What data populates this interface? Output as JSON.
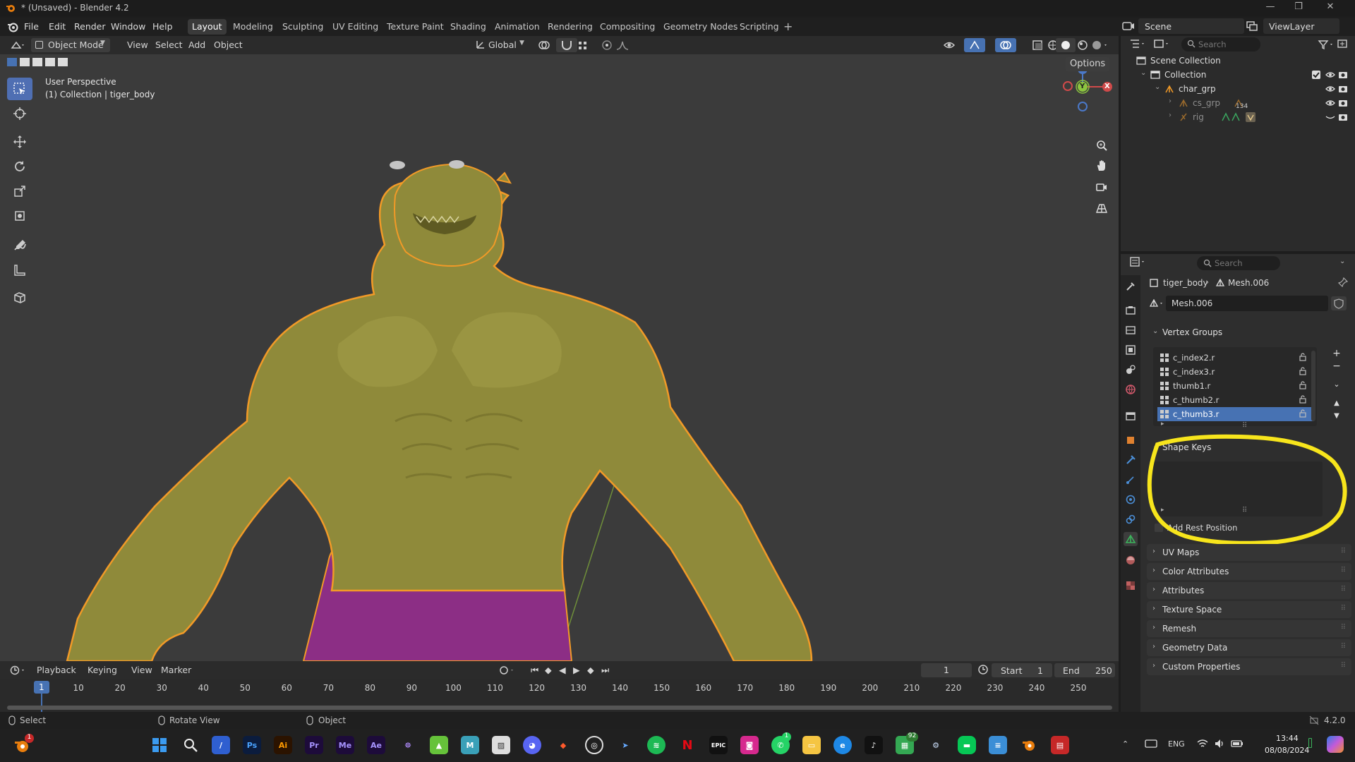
{
  "window": {
    "title": "* (Unsaved) - Blender 4.2"
  },
  "menubar": {
    "menus": [
      "File",
      "Edit",
      "Render",
      "Window",
      "Help"
    ],
    "workspaces": [
      "Layout",
      "Modeling",
      "Sculpting",
      "UV Editing",
      "Texture Paint",
      "Shading",
      "Animation",
      "Rendering",
      "Compositing",
      "Geometry Nodes",
      "Scripting"
    ],
    "active_workspace": "Layout",
    "scene_label": "Scene",
    "viewlayer_label": "ViewLayer"
  },
  "viewport_header": {
    "mode": "Object Mode",
    "menus": [
      "View",
      "Select",
      "Add",
      "Object"
    ],
    "transform": "Global",
    "options": "Options"
  },
  "viewport": {
    "perspective": "User Perspective",
    "collection_info": "(1) Collection | tiger_body",
    "gizmo_axes": [
      "Z",
      "Y",
      "X"
    ]
  },
  "outliner": {
    "search_placeholder": "Search",
    "rows": [
      {
        "label": "Scene Collection",
        "depth": 0
      },
      {
        "label": "Collection",
        "depth": 1
      },
      {
        "label": "char_grp",
        "depth": 2
      },
      {
        "label": "cs_grp",
        "depth": 3,
        "badge": "134"
      },
      {
        "label": "rig",
        "depth": 3
      }
    ]
  },
  "properties": {
    "search_placeholder": "Search",
    "breadcrumb": {
      "object": "tiger_body",
      "data": "Mesh.006"
    },
    "mesh_name": "Mesh.006",
    "vertex_groups": {
      "title": "Vertex Groups",
      "items": [
        "c_index2.r",
        "c_index3.r",
        "thumb1.r",
        "c_thumb2.r",
        "c_thumb3.r"
      ],
      "selected": "c_thumb3.r"
    },
    "shape_keys": {
      "title": "Shape Keys",
      "add_rest_position": "Add Rest Position"
    },
    "panels": [
      "UV Maps",
      "Color Attributes",
      "Attributes",
      "Texture Space",
      "Remesh",
      "Geometry Data",
      "Custom Properties"
    ]
  },
  "timeline": {
    "menus": [
      "Playback",
      "Keying",
      "View",
      "Marker"
    ],
    "current_frame": "1",
    "start_label": "Start",
    "start": "1",
    "end_label": "End",
    "end": "250",
    "ticks": [
      "1",
      "10",
      "20",
      "30",
      "40",
      "50",
      "60",
      "70",
      "80",
      "90",
      "100",
      "110",
      "120",
      "130",
      "140",
      "150",
      "160",
      "170",
      "180",
      "190",
      "200",
      "210",
      "220",
      "230",
      "240",
      "250"
    ]
  },
  "statusbar": {
    "select": "Select",
    "rotate": "Rotate View",
    "object": "Object",
    "version": "4.2.0"
  },
  "taskbar": {
    "language": "ENG",
    "time": "13:44",
    "date": "08/08/2024",
    "badges": {
      "notif": "1",
      "whatsapp": "1",
      "app92": "92"
    }
  },
  "colors": {
    "selection": "#4772b3",
    "skin": "#8f8a3a",
    "outline": "#f29a27",
    "cloth": "#8c2e85",
    "annotation": "#f7e51c"
  }
}
